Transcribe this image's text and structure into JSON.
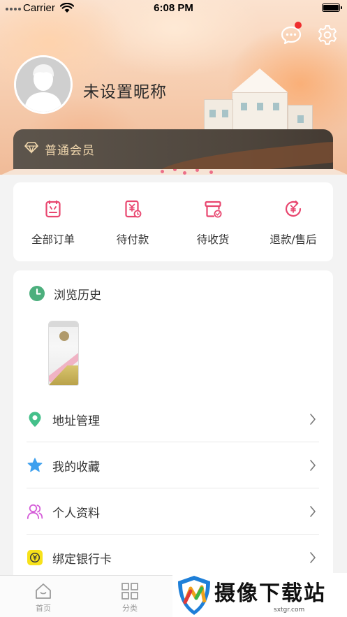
{
  "status_bar": {
    "carrier": "Carrier",
    "time": "6:08 PM",
    "battery_level": 1.0
  },
  "header": {
    "message_icon": "chat-bubble-icon",
    "settings_icon": "gear-icon",
    "has_unread_message": true,
    "avatar_icon": "default-user-avatar",
    "nickname": "未设置昵称",
    "membership": {
      "icon": "diamond-icon",
      "label": "普通会员"
    }
  },
  "orders": [
    {
      "icon": "order-list-icon",
      "label": "全部订单"
    },
    {
      "icon": "pending-payment-icon",
      "label": "待付款"
    },
    {
      "icon": "pending-receipt-icon",
      "label": "待收货"
    },
    {
      "icon": "refund-icon",
      "label": "退款/售后"
    }
  ],
  "history": {
    "icon": "clock-icon",
    "title": "浏览历史",
    "items": [
      {
        "image": "product-bag-thumbnail"
      }
    ]
  },
  "menu": [
    {
      "icon": "location-pin-icon",
      "label": "地址管理"
    },
    {
      "icon": "star-icon",
      "label": "我的收藏"
    },
    {
      "icon": "person-icon",
      "label": "个人资料"
    },
    {
      "icon": "bank-card-icon",
      "label": "绑定银行卡"
    }
  ],
  "tabbar": [
    {
      "icon": "home-icon",
      "label": "首页"
    },
    {
      "icon": "category-grid-icon",
      "label": "分类"
    }
  ],
  "watermark": {
    "text": "摄像下载站",
    "url": "sxtgr.com"
  },
  "colors": {
    "accent_pink": "#e8466f",
    "member_gold": "#f2d8ae",
    "member_bar": "#4f463d",
    "page_bg": "#f3f3f3"
  }
}
